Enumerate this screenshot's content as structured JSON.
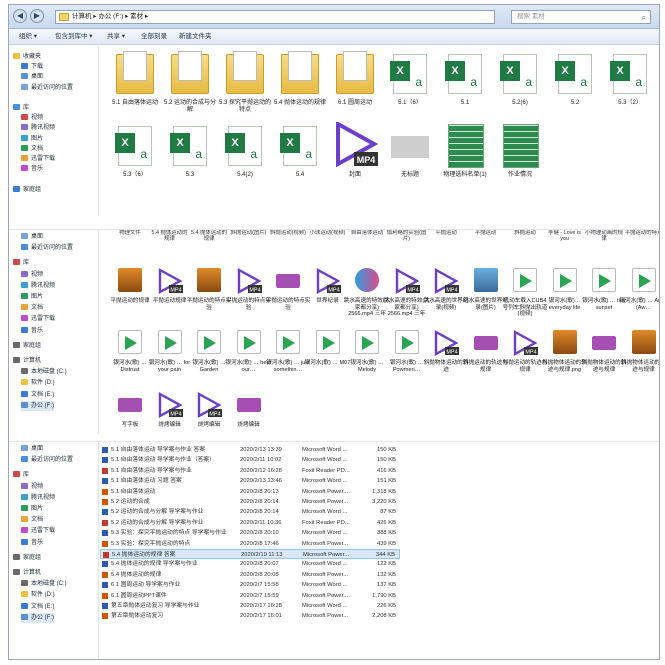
{
  "address": {
    "segments": [
      "计算机",
      "办公 (F:)",
      "素材"
    ]
  },
  "search": {
    "placeholder": "搜索 素材"
  },
  "toolbar": {
    "organize": "组织 ▾",
    "open_with": "包含到库中 ▾",
    "share": "共享 ▾",
    "burn": "全部刻录",
    "new_folder": "新建文件夹"
  },
  "nav_top": [
    {
      "label": "收藏夹",
      "y": 0
    },
    {
      "label": "下载",
      "y": 1
    },
    {
      "label": "桌面",
      "y": 2
    },
    {
      "label": "最近访问的位置",
      "y": 3
    },
    {
      "label": "库",
      "y": 5
    },
    {
      "label": "视频",
      "y": 6
    },
    {
      "label": "腾讯视频",
      "y": 7
    },
    {
      "label": "图片",
      "y": 8
    },
    {
      "label": "文档",
      "y": 9
    },
    {
      "label": "迅雷下载",
      "y": 10
    },
    {
      "label": "音乐",
      "y": 11
    },
    {
      "label": "家庭组",
      "y": 13
    }
  ],
  "row1": [
    {
      "label": "5.1 自由落体运动",
      "kind": "folder"
    },
    {
      "label": "5.2 运动的合成与分解",
      "kind": "folder"
    },
    {
      "label": "5.3 探究平抛运动的特点",
      "kind": "folder"
    },
    {
      "label": "5.4 抛体运动的规律",
      "kind": "folder"
    },
    {
      "label": "6.1 圆周运动",
      "kind": "folder"
    },
    {
      "label": "5.1（6）",
      "kind": "xls"
    },
    {
      "label": "5.1",
      "kind": "xls"
    },
    {
      "label": "5.2(6)",
      "kind": "xls"
    },
    {
      "label": "5.2",
      "kind": "xls"
    },
    {
      "label": "5.3（2）",
      "kind": "xls"
    }
  ],
  "row2": [
    {
      "label": "5.3（6）",
      "kind": "xls"
    },
    {
      "label": "5.3",
      "kind": "xls"
    },
    {
      "label": "5.4(2)",
      "kind": "xls"
    },
    {
      "label": "5.4",
      "kind": "xls"
    },
    {
      "label": "封面",
      "kind": "mp4"
    },
    {
      "label": "无标题",
      "kind": "blank"
    },
    {
      "label": "物理选科名单(1)",
      "kind": "grid"
    },
    {
      "label": "作业情况",
      "kind": "grid"
    }
  ],
  "pane2": {
    "nav": [
      "桌面",
      "最近访问的位置",
      "库",
      "视频",
      "腾讯视频",
      "图片",
      "文档",
      "迅雷下载",
      "音乐",
      "家庭组",
      "计算机",
      "本地磁盘 (C:)",
      "软件 (D:)",
      "文档 (E:)",
      "办公 (F:)"
    ],
    "top_labels": [
      "物理文件",
      "5.4 抛体运动的规律",
      "5.4 抛体运动的规律",
      "斜抛运动(图片)",
      "斜抛运动(视频)",
      "小球运动(视频)",
      "自由落体运动",
      "伽利略的实验(图片)",
      "平抛运动",
      "平抛运动",
      "斜抛运动",
      "李健 - Love is you",
      "小物理动画的规律",
      "平抛运动的特点"
    ],
    "row_a": [
      {
        "label": "平抛运动的规律",
        "kind": "mp3"
      },
      {
        "label": "平抛运动规律",
        "kind": "mp4"
      },
      {
        "label": "平抛运动的特点实验",
        "kind": "mp3"
      },
      {
        "label": "平抛运动的特点实验",
        "kind": "mp4"
      },
      {
        "label": "平抛运动的特点实验",
        "kind": "film"
      },
      {
        "label": "世界纪录",
        "kind": "mp4"
      },
      {
        "label": "跳水高速的特效(大家都分享) 2566.mp4 三年",
        "kind": "youku"
      },
      {
        "label": "跳水高速的特效(大家都分享) 2566.mp4 三年",
        "kind": "mp4"
      },
      {
        "label": "跳水高速的世界纪录(视频)",
        "kind": "mp4"
      },
      {
        "label": "跳水高速的世界纪录(图片)",
        "kind": "img"
      },
      {
        "label": "机动车载入CUB4号列车斜抛出轨道(视频)",
        "kind": "audio"
      },
      {
        "label": "银河水(歌)… everyday life",
        "kind": "audio"
      },
      {
        "label": "银河水(歌) … tiny sunset",
        "kind": "audio"
      },
      {
        "label": "银河水(歌) … Aurel (Aw…",
        "kind": "audio"
      }
    ],
    "row_b": [
      {
        "label": "银河水(歌) … Distrust",
        "kind": "audio"
      },
      {
        "label": "银河水(歌) … for your pain",
        "kind": "audio"
      },
      {
        "label": "银河水(歌) … Garden",
        "kind": "audio"
      },
      {
        "label": "银河水(歌) … hear our…",
        "kind": "audio"
      },
      {
        "label": "银河水(歌) … just somethin…",
        "kind": "audio"
      },
      {
        "label": "银河水(歌) … M07",
        "kind": "audio"
      },
      {
        "label": "银河水(歌) … Melody",
        "kind": "audio"
      },
      {
        "label": "银河水(歌) … Powmeri…",
        "kind": "audio"
      },
      {
        "label": "斜抛物体运动的轨迹",
        "kind": "mp4"
      },
      {
        "label": "斜抛运动的轨迹与规律",
        "kind": "film"
      },
      {
        "label": "斜抛运动的轨迹与规律",
        "kind": "mp4"
      },
      {
        "label": "斜抛物体运动的轨迹与规律.png",
        "kind": "mp3"
      },
      {
        "label": "斜抛物体运动的轨迹与规律",
        "kind": "film"
      },
      {
        "label": "斜抛物体运动的轨迹与规律",
        "kind": "mp3"
      }
    ],
    "row_c": [
      {
        "label": "写字板",
        "kind": "film"
      },
      {
        "label": "烧烤编辑",
        "kind": "mp4"
      },
      {
        "label": "烧烤编辑",
        "kind": "mp4"
      },
      {
        "label": "烧烤编辑",
        "kind": "film"
      }
    ]
  },
  "pane3": {
    "nav": [
      "桌面",
      "最近访问的位置",
      "库",
      "视频",
      "腾讯视频",
      "图片",
      "文档",
      "迅雷下载",
      "音乐",
      "家庭组",
      "计算机",
      "本地磁盘 (C:)",
      "软件 (D:)",
      "文档 (E:)",
      "办公 (F:)"
    ],
    "rows": [
      {
        "name": "5.1 自由落体运动 导学案与作业 答案",
        "date": "2020/2/13 13:39",
        "type": "Microsoft Word ...",
        "size": "150 KB",
        "icon": "word"
      },
      {
        "name": "5.1 自由落体运动 导学案与作业（答案）",
        "date": "2020/2/11 10:02",
        "type": "Microsoft Word ...",
        "size": "150 KB",
        "icon": "word"
      },
      {
        "name": "5.1 自由落体运动 导学案与作业",
        "date": "2020/2/12 16:28",
        "type": "Foxit Reader PD...",
        "size": "416 KB",
        "icon": "pdf"
      },
      {
        "name": "5.1 自由落体运动 习题 答案",
        "date": "2020/2/13 13:46",
        "type": "Microsoft Word ...",
        "size": "151 KB",
        "icon": "word"
      },
      {
        "name": "5.1 自由落体运动",
        "date": "2020/2/8 20:13",
        "type": "Microsoft Power...",
        "size": "1,318 KB",
        "icon": "ppt"
      },
      {
        "name": "5.2 运动的合成",
        "date": "2020/2/8 20:14",
        "type": "Microsoft Power...",
        "size": "3,220 KB",
        "icon": "ppt"
      },
      {
        "name": "5.2 运动的合成与分解 导学案与作业",
        "date": "2020/2/8 20:14",
        "type": "Microsoft Word ...",
        "size": "87 KB",
        "icon": "word"
      },
      {
        "name": "5.2 运动的合成与分解 导学案与作业",
        "date": "2020/2/11 10:36",
        "type": "Foxit Reader PD...",
        "size": "426 KB",
        "icon": "pdf"
      },
      {
        "name": "5.3 实验：探究平抛运动的特点 导学案与作业",
        "date": "2020/2/8 20:10",
        "type": "Microsoft Word ...",
        "size": "388 KB",
        "icon": "word"
      },
      {
        "name": "5.3 实验：探究平抛运动的特点",
        "date": "2020/2/8 17:46",
        "type": "Microsoft Power...",
        "size": "439 KB",
        "icon": "ppt"
      },
      {
        "name": "5.4 抛体运动的规律 答案",
        "date": "2020/2/19 11:13",
        "type": "Microsoft Power...",
        "size": "344 KB",
        "icon": "pdf",
        "selected": true
      },
      {
        "name": "5.4 抛体运动的规律 导学案与作业",
        "date": "2020/2/8 20:07",
        "type": "Microsoft Word ...",
        "size": "122 KB",
        "icon": "word"
      },
      {
        "name": "5.4 抛体运动的规律",
        "date": "2020/2/8 20:08",
        "type": "Microsoft Power...",
        "size": "132 KB",
        "icon": "ppt"
      },
      {
        "name": "6.1 圆周运动 导学案与作业",
        "date": "2020/2/7 15:58",
        "type": "Microsoft Word ...",
        "size": "137 KB",
        "icon": "word"
      },
      {
        "name": "6.1 圆周运动PPT课件",
        "date": "2020/2/7 15:59",
        "type": "Microsoft Power...",
        "size": "1,790 KB",
        "icon": "ppt"
      },
      {
        "name": "第五章抛体运动复习 导学案与作业",
        "date": "2020/2/17 16:28",
        "type": "Microsoft Word ...",
        "size": "226 KB",
        "icon": "word"
      },
      {
        "name": "第五章抛体运动复习",
        "date": "2020/2/17 16:01",
        "type": "Microsoft Power...",
        "size": "2,208 KB",
        "icon": "ppt"
      }
    ]
  },
  "colors": {
    "folder": "#e9c04e",
    "excel": "#1f7a43",
    "mp4": "#6b3fc9",
    "audio": "#2aa352",
    "film": "#a54fb3",
    "select": "#d7e8fb"
  }
}
